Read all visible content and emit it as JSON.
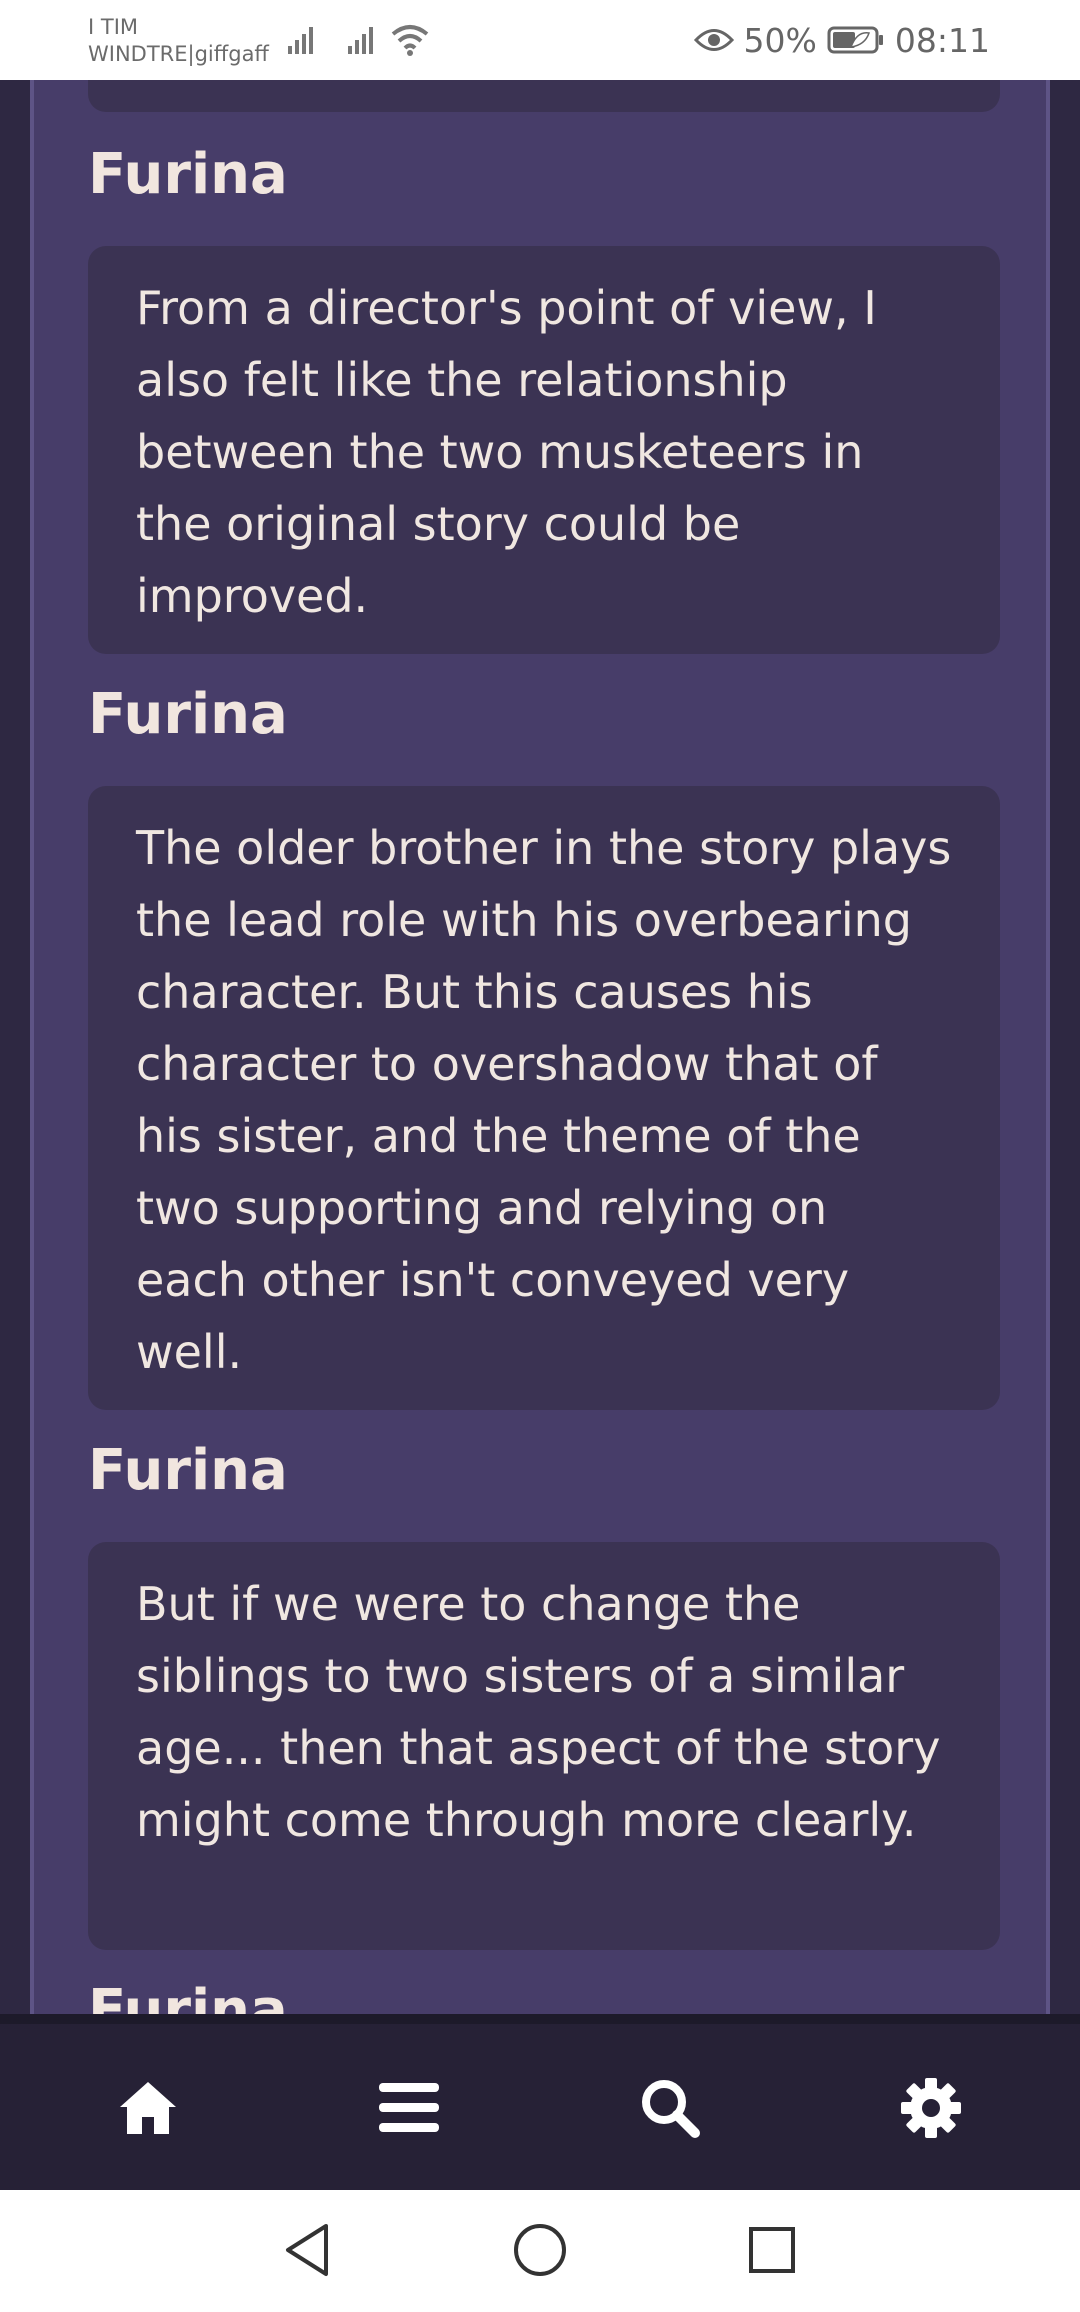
{
  "status_bar": {
    "carrier_line1": "I TIM",
    "carrier_line2": "WINDTRE|giffgaff",
    "battery": "50%",
    "time": "08:11"
  },
  "dialogue": [
    {
      "speaker": "",
      "text": ""
    },
    {
      "speaker": "Furina",
      "text": "From a director's point of view, I also felt like the relationship between the two musketeers in the original story could be improved."
    },
    {
      "speaker": "Furina",
      "text": "The older brother in the story plays the lead role with his overbearing character. But this causes his character to overshadow that of his sister, and the theme of the two supporting and relying on each other isn't conveyed very well."
    },
    {
      "speaker": "Furina",
      "text": "But if we were to change the siblings to two sisters of a similar age... then that aspect of the story might come through more clearly."
    },
    {
      "speaker": "Furina",
      "text": ""
    }
  ],
  "bottom_nav": {
    "items": [
      {
        "icon": "home-icon"
      },
      {
        "icon": "menu-icon"
      },
      {
        "icon": "search-icon"
      },
      {
        "icon": "gear-icon"
      }
    ]
  },
  "colors": {
    "panel": "#473d69",
    "bubble": "#3b3353",
    "text": "#f0e7e1",
    "nav_bg": "#262136"
  }
}
